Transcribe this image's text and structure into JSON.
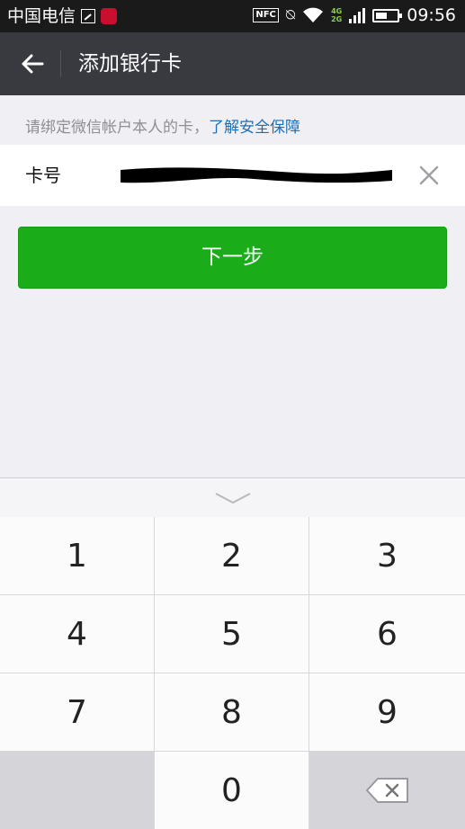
{
  "status_bar": {
    "carrier": "中国电信",
    "nfc": "NFC",
    "network_top": "4G",
    "network_bottom": "2G",
    "time": "09:56"
  },
  "header": {
    "title": "添加银行卡"
  },
  "notice": {
    "text": "请绑定微信帐户本人的卡，",
    "link": "了解安全保障"
  },
  "card_field": {
    "label": "卡号",
    "value_redacted": true
  },
  "next_button": {
    "label": "下一步"
  },
  "keypad": {
    "keys": [
      "1",
      "2",
      "3",
      "4",
      "5",
      "6",
      "7",
      "8",
      "9",
      "",
      "0",
      ""
    ]
  },
  "colors": {
    "accent_green": "#1aad19",
    "link_blue": "#1f6fb5",
    "title_bar": "#393a3f"
  },
  "icons": [
    "back-arrow-icon",
    "clear-icon",
    "keyboard-collapse-icon",
    "backspace-icon"
  ]
}
